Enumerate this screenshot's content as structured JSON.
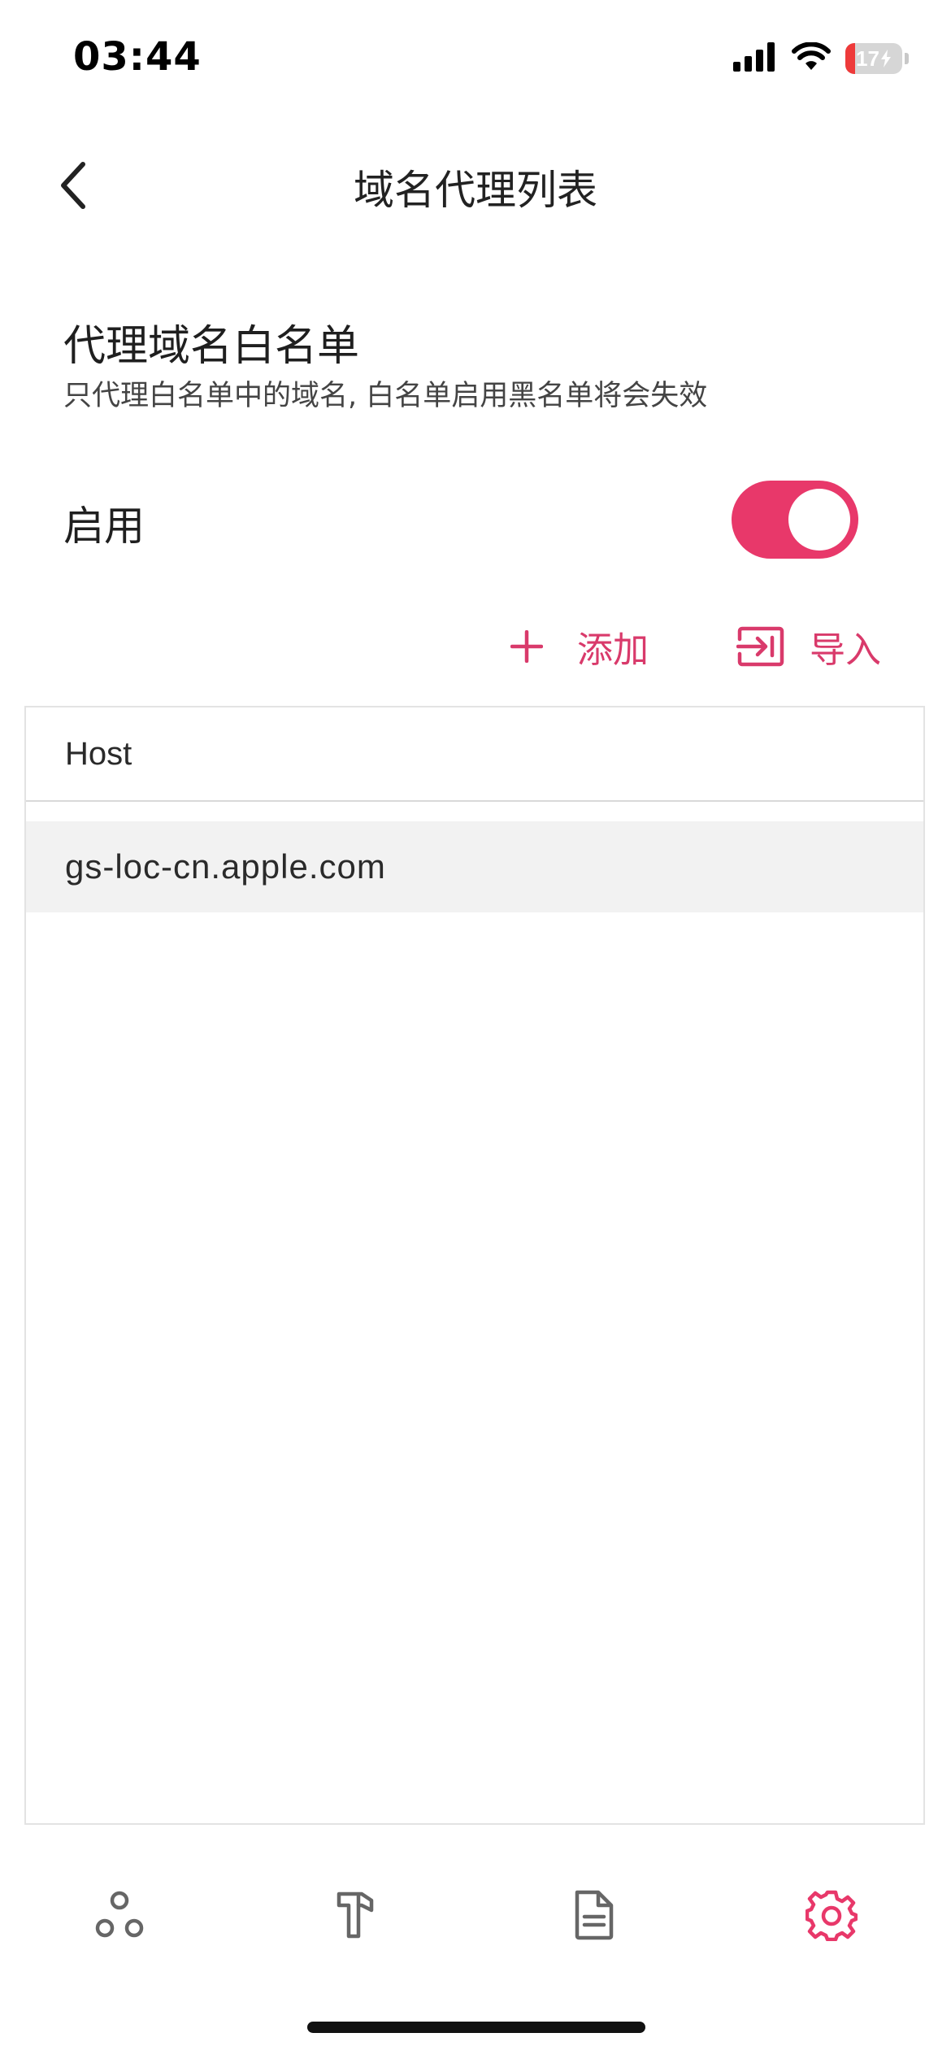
{
  "status_bar": {
    "time": "03:44",
    "battery_level": "17",
    "battery_fraction": 0.17,
    "battery_color": "#ee3a3a",
    "icons": [
      "cellular-signal-icon",
      "wifi-icon",
      "battery-charging-icon"
    ]
  },
  "nav": {
    "title": "域名代理列表",
    "back_icon": "chevron-left-icon"
  },
  "section": {
    "title": "代理域名白名单",
    "subtitle": "只代理白名单中的域名, 白名单启用黑名单将会失效"
  },
  "enable": {
    "label": "启用",
    "value": true,
    "accent_color": "#e8386a"
  },
  "actions": {
    "add_label": "添加",
    "add_icon": "plus-icon",
    "import_label": "导入",
    "import_icon": "import-icon",
    "color": "#d93a6b"
  },
  "table": {
    "columns": [
      "Host"
    ],
    "rows": [
      {
        "host": "gs-loc-cn.apple.com"
      }
    ]
  },
  "tab_bar": {
    "tabs": [
      {
        "icon": "proxy-nodes-icon",
        "active": false
      },
      {
        "icon": "hammer-tools-icon",
        "active": false
      },
      {
        "icon": "document-icon",
        "active": false
      },
      {
        "icon": "gear-icon",
        "active": true
      }
    ],
    "active_color": "#e8386a",
    "inactive_color": "#666666"
  }
}
